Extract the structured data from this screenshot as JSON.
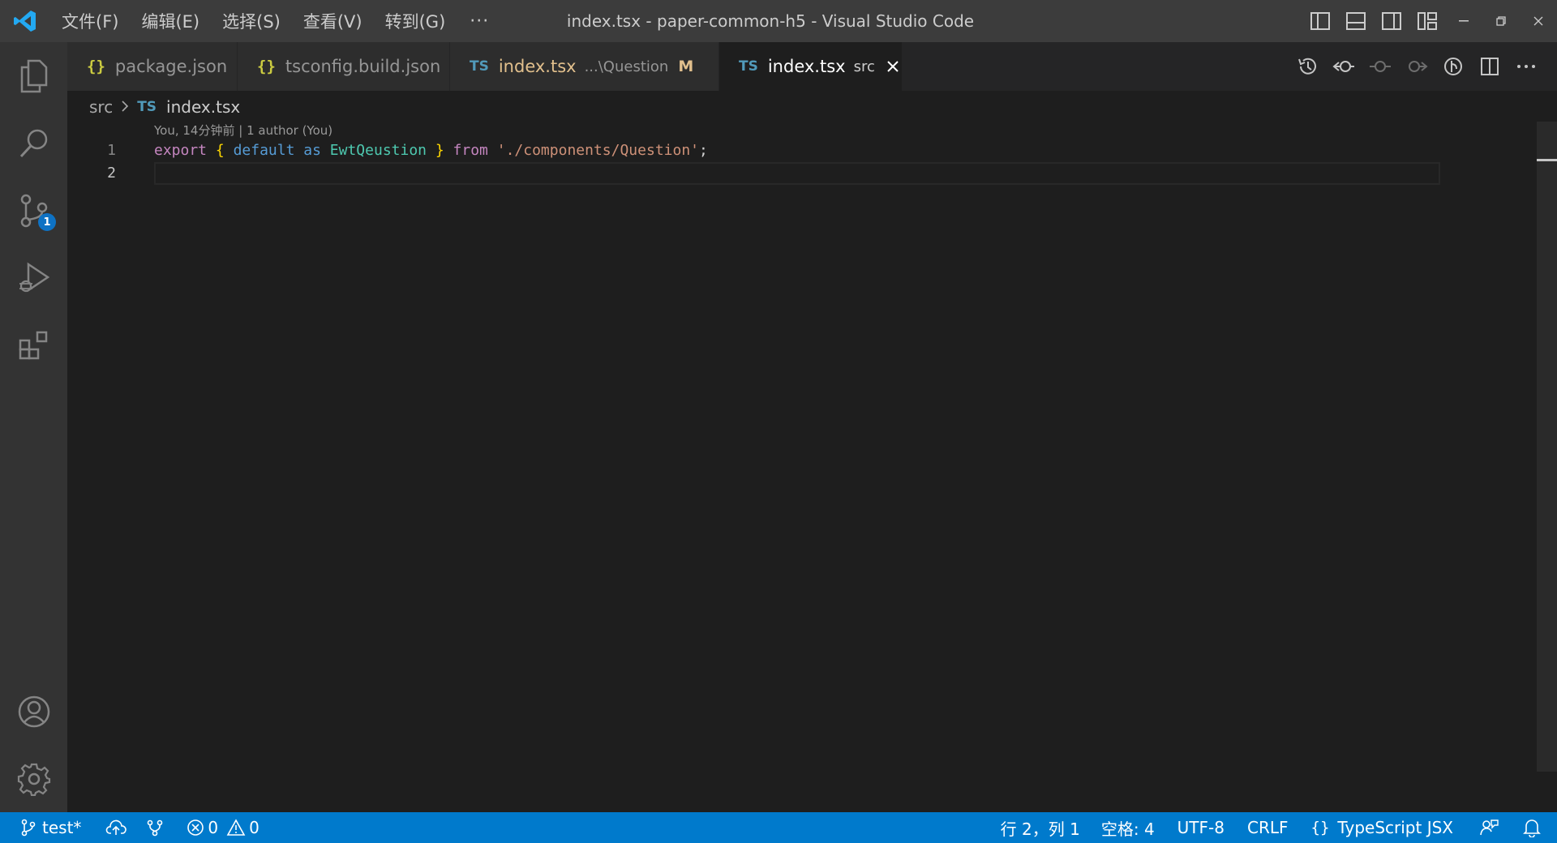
{
  "window": {
    "title": "index.tsx - paper-common-h5 - Visual Studio Code",
    "menu": [
      "文件(F)",
      "编辑(E)",
      "选择(S)",
      "查看(V)",
      "转到(G)"
    ],
    "more": "···"
  },
  "activity": {
    "scm_badge": "1"
  },
  "tabs": [
    {
      "icon": "{}",
      "name": "package.json",
      "desc": "",
      "modified": ""
    },
    {
      "icon": "{}",
      "name": "tsconfig.build.json",
      "desc": "",
      "modified": ""
    },
    {
      "icon": "TS",
      "name": "index.tsx",
      "desc": "...\\Question",
      "modified": "M"
    },
    {
      "icon": "TS",
      "name": "index.tsx",
      "desc": "src",
      "modified": "",
      "active": true
    }
  ],
  "breadcrumb": {
    "folder": "src",
    "file_icon": "TS",
    "file": "index.tsx"
  },
  "editor": {
    "codelens": "You, 14分钟前 | 1 author (You)",
    "line_numbers": [
      "1",
      "2"
    ],
    "tokens": {
      "export": "export",
      "open_brace": "{",
      "default": "default",
      "as": "as",
      "name": "EwtQeustion",
      "close_brace": "}",
      "from": "from",
      "path": "'./components/Question'",
      "semi": ";"
    }
  },
  "statusbar": {
    "branch": "test*",
    "errors": "0",
    "warnings": "0",
    "position": "行 2，列 1",
    "spaces": "空格: 4",
    "encoding": "UTF-8",
    "eol": "CRLF",
    "language": "TypeScript JSX"
  },
  "colors": {
    "titlebar": "#3c3c3c",
    "activitybar": "#333333",
    "editor_bg": "#1e1e1e",
    "statusbar": "#007acc",
    "accent": "#0e72c4"
  }
}
